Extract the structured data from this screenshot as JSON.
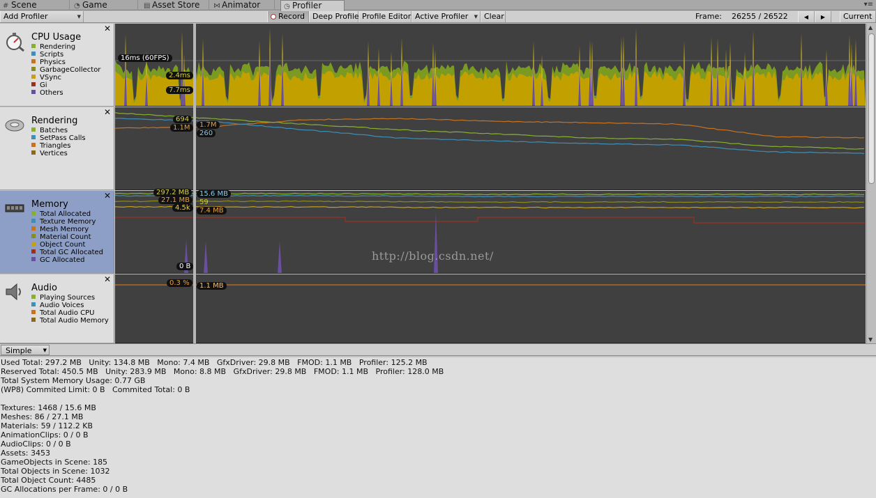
{
  "tabs": [
    {
      "label": "Scene",
      "icon": "grid-icon"
    },
    {
      "label": "Game",
      "icon": "pacman-icon"
    },
    {
      "label": "Asset Store",
      "icon": "store-icon"
    },
    {
      "label": "Animator",
      "icon": "animator-icon"
    },
    {
      "label": "Profiler",
      "icon": "stopwatch-icon"
    }
  ],
  "toolbar": {
    "add_profiler": "Add Profiler",
    "record": "Record",
    "deep_profile": "Deep Profile",
    "profile_editor": "Profile Editor",
    "active_profiler": "Active Profiler",
    "clear": "Clear",
    "frame_label": "Frame:",
    "frame_value": "26255 / 26522",
    "prev_frame": "◀",
    "next_frame": "▶",
    "current": "Current"
  },
  "modules": [
    {
      "title": "CPU Usage",
      "legend": [
        {
          "label": "Rendering",
          "color": "#88b030"
        },
        {
          "label": "Scripts",
          "color": "#3d8fb8"
        },
        {
          "label": "Physics",
          "color": "#c8721e"
        },
        {
          "label": "GarbageCollector",
          "color": "#8a8a20"
        },
        {
          "label": "VSync",
          "color": "#c8a018"
        },
        {
          "label": "Gi",
          "color": "#9a3020"
        },
        {
          "label": "Others",
          "color": "#6a4ea0"
        }
      ],
      "labels": {
        "fps_line": "16ms (60FPS)",
        "value_a": "2.4ms",
        "value_b": "7.7ms"
      }
    },
    {
      "title": "Rendering",
      "legend": [
        {
          "label": "Batches",
          "color": "#88b030"
        },
        {
          "label": "SetPass Calls",
          "color": "#3d8fb8"
        },
        {
          "label": "Triangles",
          "color": "#c8721e"
        },
        {
          "label": "Vertices",
          "color": "#8a6a20"
        }
      ],
      "labels": {
        "batches": "694",
        "triangles": "1.1M",
        "vertices": "1.7M",
        "setpass": "260"
      }
    },
    {
      "title": "Memory",
      "legend": [
        {
          "label": "Total Allocated",
          "color": "#88b030"
        },
        {
          "label": "Texture Memory",
          "color": "#3d8fb8"
        },
        {
          "label": "Mesh Memory",
          "color": "#c8721e"
        },
        {
          "label": "Material Count",
          "color": "#8a8a20"
        },
        {
          "label": "Object Count",
          "color": "#c8a018"
        },
        {
          "label": "Total GC Allocated",
          "color": "#9a3020"
        },
        {
          "label": "GC Allocated",
          "color": "#6a4ea0"
        }
      ],
      "labels": {
        "total": "297.2 MB",
        "mesh": "27.1 MB",
        "objects": "4.5k",
        "gc": "0 B",
        "texture": "15.6 MB",
        "materials": "59",
        "gc_total": "7.4 MB"
      }
    },
    {
      "title": "Audio",
      "legend": [
        {
          "label": "Playing Sources",
          "color": "#88b030"
        },
        {
          "label": "Audio Voices",
          "color": "#3d8fb8"
        },
        {
          "label": "Total Audio CPU",
          "color": "#c8721e"
        },
        {
          "label": "Total Audio Memory",
          "color": "#8a6a20"
        }
      ],
      "labels": {
        "cpu": "0.3 %",
        "memory": "1.1 MB"
      }
    }
  ],
  "detail_mode": "Simple",
  "details": [
    "Used Total: 297.2 MB   Unity: 134.8 MB   Mono: 7.4 MB   GfxDriver: 29.8 MB   FMOD: 1.1 MB   Profiler: 125.2 MB",
    "Reserved Total: 450.5 MB   Unity: 283.9 MB   Mono: 8.8 MB   GfxDriver: 29.8 MB   FMOD: 1.1 MB   Profiler: 128.0 MB",
    "Total System Memory Usage: 0.77 GB",
    "(WP8) Commited Limit: 0 B   Commited Total: 0 B",
    "",
    "Textures: 1468 / 15.6 MB",
    "Meshes: 86 / 27.1 MB",
    "Materials: 59 / 112.2 KB",
    "AnimationClips: 0 / 0 B",
    "AudioClips: 0 / 0 B",
    "Assets: 3453",
    "GameObjects in Scene: 185",
    "Total Objects in Scene: 1032",
    "Total Object Count: 4485",
    "GC Allocations per Frame: 0 / 0 B"
  ],
  "watermark": "http://blog.csdn.net/"
}
